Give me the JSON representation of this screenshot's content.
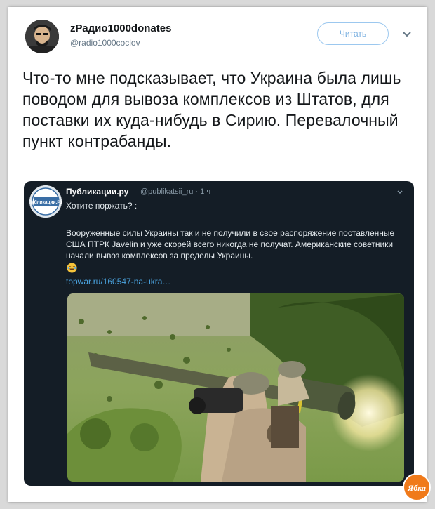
{
  "author": {
    "name": "zРадио1000donates",
    "handle": "@radio1000coclov"
  },
  "follow_button": "Читать",
  "tweet_text": "Что-то мне подсказывает, что Украина была лишь поводом для вывоза комплексов из Штатов, для поставки их куда-нибудь в Сирию. Перевалочный пункт контрабанды.",
  "quoted": {
    "author_name": "Публикации.ру",
    "meta": "@publikatsii_ru · 1 ч",
    "line1": "Хотите поржать? :",
    "body": "Вооруженные силы Украины так и не получили в свое распоряжение поставленные США ПТРК Javelin и уже скорей всего никогда не получат. Американские советники начали вывоз комплексов за пределы Украины.",
    "emoji": "rolling-on-floor-laughing-emoji",
    "link": "topwar.ru/160547-na-ukra…",
    "avatar_text": "Публикации.РУ"
  },
  "watermark_text": "Ябка",
  "icons": {
    "follow_chevron": "chevron-down-icon",
    "quoted_chevron": "chevron-down-icon"
  },
  "colors": {
    "link": "#4aa3df",
    "quote_bg": "#141d26",
    "follow_border": "#9cc8ef",
    "watermark": "#f07a1a"
  }
}
